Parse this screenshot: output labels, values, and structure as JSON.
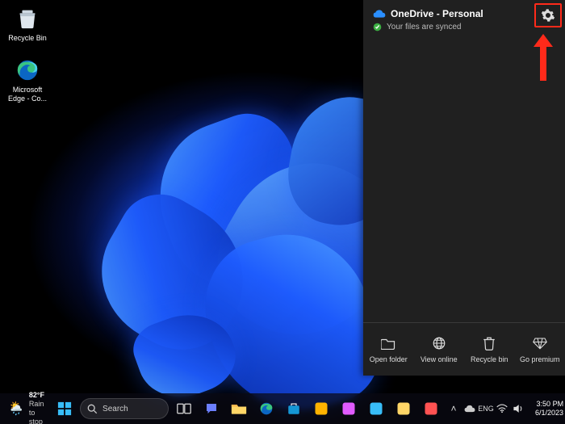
{
  "desktop_icons": [
    {
      "name": "recycle-bin",
      "label": "Recycle Bin"
    },
    {
      "name": "edge",
      "label": "Microsoft Edge - Co..."
    }
  ],
  "onedrive": {
    "title": "OneDrive - Personal",
    "status": "Your files are synced",
    "actions": {
      "open_folder": "Open folder",
      "view_online": "View online",
      "recycle_bin": "Recycle bin",
      "go_premium": "Go premium"
    }
  },
  "taskbar": {
    "weather": {
      "temp": "82°F",
      "desc": "Rain to stop"
    },
    "search_placeholder": "Search",
    "clock": {
      "time": "3:50 PM",
      "date": "6/1/2023"
    }
  },
  "colors": {
    "accent": "#1e5cff",
    "highlight": "#ff2a1a",
    "panel_bg": "#202020"
  }
}
